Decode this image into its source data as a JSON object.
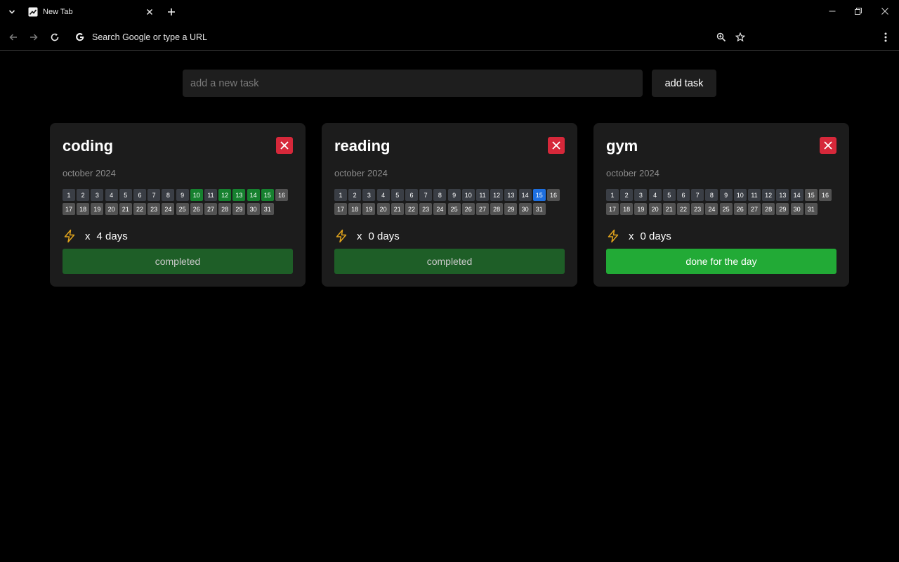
{
  "browser": {
    "tab_title": "New Tab",
    "omnibox_placeholder": "Search Google or type a URL"
  },
  "input": {
    "placeholder": "add a new task",
    "add_label": "add task"
  },
  "tasks": [
    {
      "title": "coding",
      "month": "october 2024",
      "streak_x": "x",
      "streak_text": "4 days",
      "button_label": "completed",
      "button_state": "completed",
      "completed_days": [
        10,
        12,
        13,
        14,
        15
      ],
      "today": 15
    },
    {
      "title": "reading",
      "month": "october 2024",
      "streak_x": "x",
      "streak_text": "0 days",
      "button_label": "completed",
      "button_state": "completed",
      "completed_days": [],
      "today": 15,
      "today_highlight": true
    },
    {
      "title": "gym",
      "month": "october 2024",
      "streak_x": "x",
      "streak_text": "0 days",
      "button_label": "done for the day",
      "button_state": "active",
      "completed_days": [],
      "today": 15
    }
  ],
  "days_in_month": 31,
  "colors": {
    "accent_done": "#16812f",
    "accent_today": "#1d6fe0",
    "delete": "#d6283a",
    "streak_icon": "#e0a31c",
    "button_active": "#22aa36",
    "button_completed": "#1e5e27"
  }
}
